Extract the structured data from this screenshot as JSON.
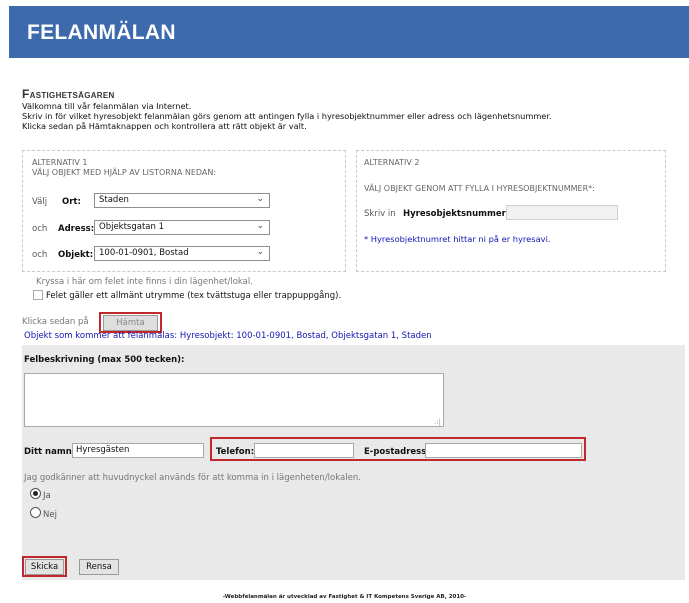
{
  "header": {
    "title": "FELANMÄLAN"
  },
  "owner": {
    "title": "Fastighetsägaren",
    "intro_lines": [
      "Välkomna till vår felanmälan via Internet.",
      "Skriv in för vilket hyresobjekt felanmälan görs genom att antingen fylla i hyresobjektnummer eller adress och lägenhetsnummer.",
      "Klicka sedan på Hämtaknappen och kontrollera att rätt objekt är valt."
    ]
  },
  "alt1": {
    "title": "ALTERNATIV 1",
    "subtitle": "VÄLJ OBJEKT MED HJÄLP AV LISTORNA NEDAN:",
    "ort_prefix": "Välj",
    "ort_label": "Ort:",
    "ort_value": "Staden",
    "adress_prefix": "och",
    "adress_label": "Adress:",
    "adress_value": "Objektsgatan 1",
    "objekt_prefix": "och",
    "objekt_label": "Objekt:",
    "objekt_value": "100-01-0901, Bostad"
  },
  "alt2": {
    "title": "ALTERNATIV 2",
    "subtitle": "VÄLJ OBJEKT GENOM ATT FYLLA I HYRESOBJEKTNUMMER*:",
    "input_prefix": "Skriv in",
    "input_label": "Hyresobjektsnummer:",
    "input_value": "",
    "hint": "* Hyresobjektnumret hittar ni på er hyresavi."
  },
  "options": {
    "apartment_text": "Kryssa i här om felet inte finns i din lägenhet/lokal.",
    "common_area_label": "Felet gäller ett allmänt utrymme (tex tvättstuga eller trappuppgång)."
  },
  "fetch": {
    "prefix": "Klicka sedan på",
    "button": "Hämta",
    "selected_object": "Objekt som kommer att felanmälas: Hyresobjekt: 100-01-0901, Bostad, Objektsgatan 1, Staden"
  },
  "report": {
    "description_label": "Felbeskrivning (max 500 tecken):",
    "description_value": "",
    "name_label": "Ditt namn:",
    "name_value": "Hyresgästen",
    "phone_label": "Telefon:",
    "phone_value": "",
    "email_label": "E-postadress:",
    "email_value": "",
    "consent_text": "Jag godkänner att huvudnyckel används för att komma in i lägenheten/lokalen.",
    "yes_label": "Ja",
    "no_label": "Nej",
    "consent_selected": "Ja"
  },
  "actions": {
    "submit": "Skicka",
    "reset": "Rensa"
  },
  "footer": {
    "text": "-Webbfelanmälan är utvecklad av Fastighet & IT Kompetens Sverige AB, 2010-"
  },
  "icons": {
    "select_caret": "chevron-down-icon",
    "resize_grip": "resize-grip-icon"
  },
  "colors": {
    "header_bg": "#3d6aad",
    "link_blue": "#1414b4",
    "highlight_red": "#c0282d",
    "panel_bg": "#e9e9e9"
  }
}
